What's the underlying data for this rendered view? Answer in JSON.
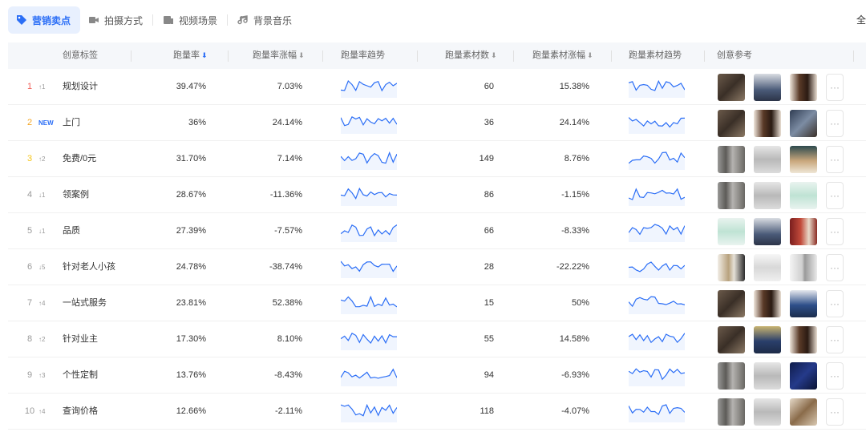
{
  "tabs": [
    {
      "label": "营销卖点",
      "icon": "tag-icon",
      "active": true
    },
    {
      "label": "拍摄方式",
      "icon": "video-camera-icon",
      "active": false
    },
    {
      "label": "视频场景",
      "icon": "scene-icon",
      "active": false
    },
    {
      "label": "背景音乐",
      "icon": "music-note-icon",
      "active": false
    }
  ],
  "tab_right_label": "全",
  "headers": {
    "label": "创意标签",
    "run_rate": "跑量率",
    "run_rate_change": "跑量率涨幅",
    "run_rate_trend": "跑量率趋势",
    "material_count": "跑量素材数",
    "material_change": "跑量素材涨幅",
    "material_trend": "跑量素材趋势",
    "creative_ref": "创意参考"
  },
  "accent_color": "#2b6ef6",
  "rank_colors": {
    "1": "#f0605a",
    "2": "#f5a623",
    "3": "#f5c518",
    "default": "#999999"
  },
  "more_label": "···",
  "rows": [
    {
      "rank": "1",
      "change": "↑1",
      "label": "规划设计",
      "rate": "39.47%",
      "rate_change": "7.03%",
      "count": "60",
      "count_change": "15.38%",
      "thumbs": [
        "room-dark",
        "person",
        "door-dark"
      ]
    },
    {
      "rank": "2",
      "change": "NEW",
      "label": "上门",
      "rate": "36%",
      "rate_change": "24.14%",
      "count": "36",
      "count_change": "24.14%",
      "thumbs": [
        "room-dark",
        "door-dark",
        "room-blue"
      ]
    },
    {
      "rank": "3",
      "change": "↑2",
      "label": "免费/0元",
      "rate": "31.70%",
      "rate_change": "7.14%",
      "count": "149",
      "count_change": "8.76%",
      "thumbs": [
        "cabinet-gray",
        "cabinet-light",
        "bedroom"
      ]
    },
    {
      "rank": "4",
      "change": "↓1",
      "label": "领案例",
      "rate": "28.67%",
      "rate_change": "-11.36%",
      "count": "86",
      "count_change": "-1.15%",
      "thumbs": [
        "cabinet-gray",
        "cabinet-light",
        "poster-green"
      ]
    },
    {
      "rank": "5",
      "change": "↓1",
      "label": "品质",
      "rate": "27.39%",
      "rate_change": "-7.57%",
      "count": "66",
      "count_change": "-8.33%",
      "thumbs": [
        "poster-green",
        "person",
        "curtain-red"
      ]
    },
    {
      "rank": "6",
      "change": "↓5",
      "label": "针对老人小孩",
      "rate": "24.78%",
      "rate_change": "-38.74%",
      "count": "28",
      "count_change": "-22.22%",
      "thumbs": [
        "hall-light",
        "wall-white",
        "closet-white"
      ]
    },
    {
      "rank": "7",
      "change": "↑4",
      "label": "一站式服务",
      "rate": "23.81%",
      "rate_change": "52.38%",
      "count": "15",
      "count_change": "50%",
      "thumbs": [
        "room-dark",
        "door-dark",
        "person-blue"
      ]
    },
    {
      "rank": "8",
      "change": "↑2",
      "label": "针对业主",
      "rate": "17.30%",
      "rate_change": "8.10%",
      "count": "55",
      "count_change": "14.58%",
      "thumbs": [
        "room-dark",
        "person-suit",
        "door-dark"
      ]
    },
    {
      "rank": "9",
      "change": "↑3",
      "label": "个性定制",
      "rate": "13.76%",
      "rate_change": "-8.43%",
      "count": "94",
      "count_change": "-6.93%",
      "thumbs": [
        "cabinet-gray",
        "cabinet-light",
        "night-navy"
      ]
    },
    {
      "rank": "10",
      "change": "↑4",
      "label": "查询价格",
      "rate": "12.66%",
      "rate_change": "-2.11%",
      "count": "118",
      "count_change": "-4.07%",
      "thumbs": [
        "cabinet-gray",
        "cabinet-light",
        "desk-brown"
      ]
    }
  ]
}
